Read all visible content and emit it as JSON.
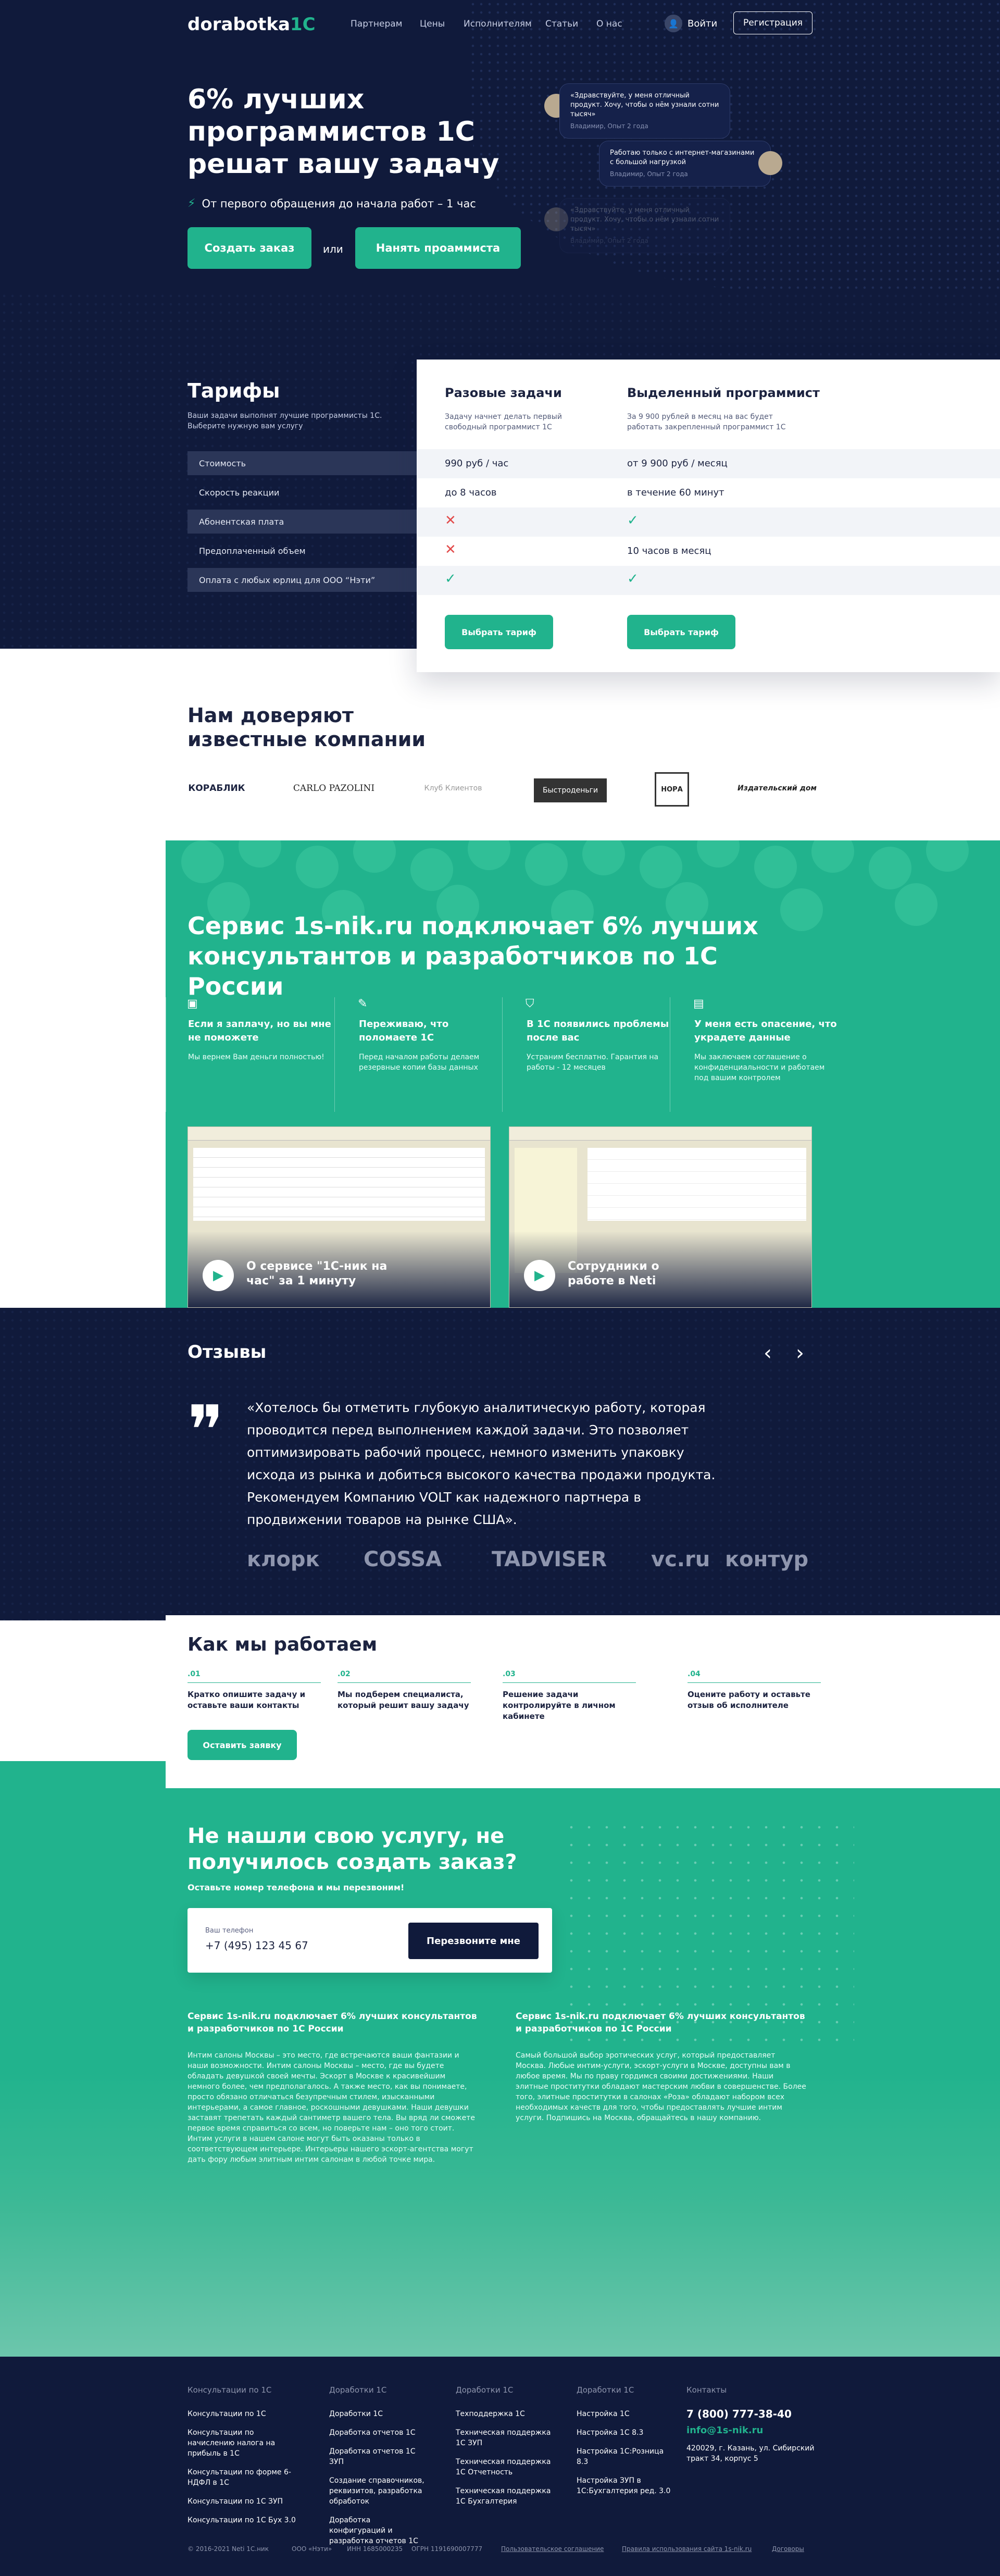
{
  "header": {
    "logo_text": "dorabotka",
    "logo_accent": "1C",
    "nav": [
      "Партнерам",
      "Цены",
      "Исполнителям",
      "Статьи",
      "О нас"
    ],
    "login": "Войти",
    "register": "Регистрация"
  },
  "hero": {
    "title": "6% лучших программистов 1С решат вашу задачу",
    "subtitle": "От первого обращения до начала работ – 1 час",
    "btn_order": "Создать заказ",
    "or": "или",
    "btn_hire": "Нанять проаммиста",
    "chats": [
      {
        "text": "«Здравствуйте, у меня отличный продукт. Хочу, чтобы о нём узнали сотни тысяч»",
        "who": "Владимир, Опыт 2 года"
      },
      {
        "text": "Работаю только с интернет-магазинами с большой нагрузкой",
        "who": "Владимир, Опыт 2 года"
      },
      {
        "text": "«Здравствуйте, у меня отличный продукт. Хочу, чтобы о нём узнали сотни тысяч»",
        "who": "Владимир, Опыт 2 года"
      }
    ]
  },
  "tariffs": {
    "title": "Тарифы",
    "desc": "Ваши задачи выполнят лучшие программисты 1С. Выберите нужную вам услугу",
    "rows": [
      "Стоимость",
      "Скорость реакции",
      "Абонентская плата",
      "Предоплаченный объем",
      "Оплата с любых юрлиц для ООО “Нэти”"
    ],
    "plan1": {
      "title": "Разовые задачи",
      "desc": "Задачу начнет делать первый свободный программист 1С",
      "values": [
        "990 руб / час",
        "до 8 часов"
      ],
      "btn": "Выбрать тариф"
    },
    "plan2": {
      "title": "Выделенный программист",
      "desc": "За 9 900 рублей в месяц на вас будет работать закрепленный программист 1С",
      "values": [
        "от 9 900 руб / месяц",
        "в течение 60 минут",
        "",
        "10 часов в месяц"
      ],
      "btn": "Выбрать тариф"
    }
  },
  "trust": {
    "title": "Нам доверяют известные компании",
    "logos": [
      "КОРАБЛИК",
      "CARLO PAZOLINI",
      "Клуб Клиентов",
      "Быстроденьги",
      "НОРА",
      "Издательский дом"
    ]
  },
  "service": {
    "title": "Сервис 1s-nik.ru подключает 6% лучших консультантов и разработчиков по 1С России",
    "features": [
      {
        "title": "Если я заплачу, но вы мне не поможете",
        "desc": "Мы вернем Вам деньги полностью!"
      },
      {
        "title": "Переживаю, что поломаете 1С",
        "desc": "Перед началом работы делаем резервные копии базы данных"
      },
      {
        "title": "В 1С появились проблемы после вас",
        "desc": "Устраним бесплатно. Гарантия на работы - 12 месяцев"
      },
      {
        "title": "У меня есть опасение, что украдете данные",
        "desc": "Мы заключаем соглашение о конфиденциальности и работаем под вашим контролем"
      }
    ],
    "videos": [
      "О сервисе \"1С-ник на час\" за 1 минуту",
      "Сотрудники о работе в Neti"
    ]
  },
  "reviews": {
    "title": "Отзывы",
    "quote": "«Хотелось бы отметить глубокую аналитическую работу, которая проводится перед выполнением каждой задачи. Это позволяет оптимизировать рабочий процесс, немного изменить упаковку исхода из рынка и добиться высокого качества продажи продукта. Рекомендуем Компанию VOLT как надежного партнера в продвижении товаров на рынке США».",
    "partners": [
      "клорк",
      "COSSA",
      "TADVISER",
      "vc.ru",
      "контур"
    ]
  },
  "how": {
    "title": "Как мы работаем",
    "steps": [
      {
        "n": ".01",
        "t": "Кратко опишите задачу и оставьте ваши контакты"
      },
      {
        "n": ".02",
        "t": "Мы подберем специалиста, который решит вашу задачу"
      },
      {
        "n": ".03",
        "t": "Решение задачи контролируйте в личном кабинете"
      },
      {
        "n": ".04",
        "t": "Оцените работу и оставьте отзыв об исполнителе"
      }
    ],
    "btn": "Оставить заявку"
  },
  "notfound": {
    "title": "Не нашли свою услугу, не получилось создать заказ?",
    "sub": "Оставьте номер телефона и мы перезвоним!",
    "label": "Ваш телефон",
    "phone": "+7 (495) 123 45 67",
    "btn": "Перезвоните мне"
  },
  "seo": [
    {
      "title": "Сервис 1s-nik.ru подключает 6% лучших консультантов и разработчиков по 1С России",
      "text": "Интим салоны Москвы – это место, где встречаются ваши фантазии и наши возможности. Интим салоны Москвы – место, где вы будете обладать девушкой своей мечты. Эскорт в Москве к красивейшим немного более, чем предполагалось. А также место, как вы понимаете, просто обязано отличаться безупречным стилем, изысканными интерьерами, а самое главное, роскошными девушками. Наши девушки заставят трепетать каждый сантиметр вашего тела. Вы вряд ли сможете первое время справиться со всем, но поверьте нам – оно того стоит. Интим услуги в нашем салоне могут быть оказаны только в соответствующем интерьере. Интерьеры нашего эскорт-агентства могут дать фору любым элитным интим салонам в любой точке мира."
    },
    {
      "title": "Сервис 1s-nik.ru подключает 6% лучших консультантов и разработчиков по 1С России",
      "text": "Самый большой выбор эротических услуг, который предоставляет Москва. Любые интим-услуги, эскорт-услуги в Москве, доступны вам в любое время. Мы по праву гордимся своими достижениями. Наши элитные проститутки обладают мастерским любви в совершенстве. Более того, элитные проститутки в салонах «Роза» обладают набором всех необходимых качеств для того, чтобы предоставлять лучшие интим услуги. Подпишись на Москва, обращайтесь в нашу компанию."
    }
  ],
  "footer": {
    "cols": [
      {
        "h": "Консультации по 1С",
        "items": [
          "Консультации по 1С",
          "Консультации по начислению налога на прибыль в 1С",
          "Консультации по форме 6-НДФЛ в 1С",
          "Консультации по 1С ЗУП",
          "Консультации по 1С Бух 3.0"
        ]
      },
      {
        "h": "Доработки 1С",
        "items": [
          "Доработки 1С",
          "Доработка отчетов 1С",
          "Доработка отчетов 1С ЗУП",
          "Создание справочников, реквизитов, разработка обработок",
          "Доработка конфигураций и разработка отчетов 1С"
        ]
      },
      {
        "h": "Доработки 1С",
        "items": [
          "Техподдержка 1С",
          "Техническая поддержка 1С ЗУП",
          "Техническая поддержка 1С Отчетность",
          "Техническая поддержка 1С Бухгалтерия"
        ]
      },
      {
        "h": "Доработки 1С",
        "items": [
          "Настройка 1С",
          "Настройка 1С 8.3",
          "Настройка 1С:Розница 8.3",
          "Настройка ЗУП в 1С:Бухгалтерия ред. 3.0"
        ]
      }
    ],
    "contacts": {
      "h": "Контакты",
      "phone": "7 (800) 777-38-40",
      "email": "info@1s-nik.ru",
      "address": "420029, г. Казань, ул. Сибирский тракт 34, корпус 5"
    },
    "bottom": [
      "© 2016-2021 Neti 1C.ник",
      "ООО «Нэти»",
      "ИНН 1685000235",
      "ОГРН 1191690007777",
      "Пользовательское соглашение",
      "Правила использования сайта 1s-nik.ru",
      "Договоры"
    ]
  },
  "colors": {
    "navy": "#101a3b",
    "green": "#21b38d"
  }
}
